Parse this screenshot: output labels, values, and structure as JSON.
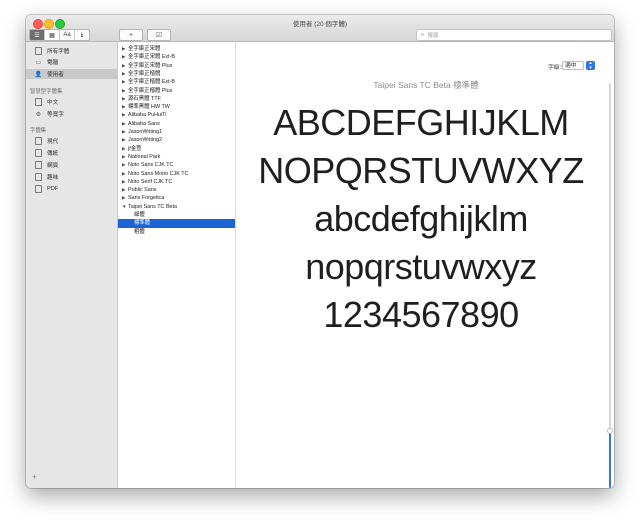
{
  "window": {
    "title": "使用者 (20 個字體)"
  },
  "toolbar": {
    "view_buttons": [
      {
        "icon": "sidebar-icon",
        "glyph": "☰"
      },
      {
        "icon": "grid-icon",
        "glyph": "▦"
      },
      {
        "label": "Aa"
      },
      {
        "icon": "info-icon",
        "glyph": "ℹ"
      }
    ],
    "add_glyph": "+",
    "check_glyph": "☑",
    "search_placeholder": "搜尋"
  },
  "sidebar": {
    "top_items": [
      {
        "label": "所有字體",
        "icon": "font-book-icon"
      },
      {
        "label": "電腦",
        "icon": "computer-icon"
      },
      {
        "label": "使用者",
        "icon": "user-icon",
        "selected": true
      }
    ],
    "lang_header": "智慧型字體集",
    "lang_items": [
      {
        "label": "中文",
        "icon": "collection-icon"
      },
      {
        "label": "等寬字",
        "icon": "gear-icon"
      }
    ],
    "coll_header": "字體集",
    "coll_items": [
      {
        "label": "現代"
      },
      {
        "label": "傳統"
      },
      {
        "label": "網頁"
      },
      {
        "label": "趣味"
      },
      {
        "label": "PDF"
      }
    ],
    "plus": "+"
  },
  "fonts": [
    {
      "label": "全字庫正宋體",
      "collapsed": true
    },
    {
      "label": "全字庫正宋體 Ext-B",
      "collapsed": true
    },
    {
      "label": "全字庫正宋體 Plus",
      "collapsed": true
    },
    {
      "label": "全字庫正楷體",
      "collapsed": true
    },
    {
      "label": "全字庫正楷體 Ext-B",
      "collapsed": true
    },
    {
      "label": "全字庫正楷體 Plus",
      "collapsed": true
    },
    {
      "label": "源石黑體 TTF",
      "collapsed": true
    },
    {
      "label": "標準黑體 HW TW",
      "collapsed": true
    },
    {
      "label": "Alibaba PuHuiTi",
      "collapsed": true
    },
    {
      "label": "Alibaba Sans",
      "collapsed": true
    },
    {
      "label": "JasonWriting1",
      "collapsed": true
    },
    {
      "label": "JasonWriting2",
      "collapsed": true
    },
    {
      "label": "jf金萱",
      "collapsed": true
    },
    {
      "label": "National Park",
      "collapsed": true
    },
    {
      "label": "Noto Sans CJK TC",
      "collapsed": true
    },
    {
      "label": "Noto Sans Mono CJK TC",
      "collapsed": true
    },
    {
      "label": "Noto Serif CJK TC",
      "collapsed": true
    },
    {
      "label": "Public Sans",
      "collapsed": true
    },
    {
      "label": "Sans Forgetica",
      "collapsed": true
    },
    {
      "label": "Taipei Sans TC Beta",
      "collapsed": false
    },
    {
      "label": "細體",
      "sub": true
    },
    {
      "label": "標準體",
      "sub": true,
      "selected": true
    },
    {
      "label": "粗體",
      "sub": true
    }
  ],
  "preview": {
    "size_label": "字級：",
    "size_value": "適中",
    "title": "Taipei Sans TC Beta 標準體",
    "lines": [
      "ABCDEFGHIJKLM",
      "NOPQRSTUVWXYZ",
      "abcdefghijklm",
      "nopqrstuvwxyz",
      "1234567890"
    ]
  },
  "colors": {
    "selection": "#1c64d3",
    "accent": "#2f74e8",
    "sidebar": "#e6e6e6"
  }
}
